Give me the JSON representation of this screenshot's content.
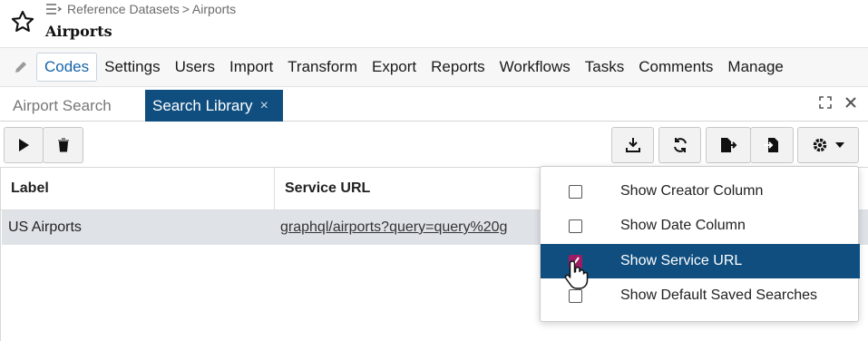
{
  "breadcrumb": {
    "parent": "Reference Datasets",
    "separator": ">",
    "current": "Airports"
  },
  "page_title": "Airports",
  "nav": [
    "Codes",
    "Settings",
    "Users",
    "Import",
    "Transform",
    "Export",
    "Reports",
    "Workflows",
    "Tasks",
    "Comments",
    "Manage"
  ],
  "tabs": {
    "inactive": "Airport Search",
    "active": "Search Library",
    "close": "×"
  },
  "table": {
    "columns": [
      "Label",
      "Service URL"
    ],
    "rows": [
      {
        "label": "US Airports",
        "url": "graphql/airports?query=query%20g"
      }
    ]
  },
  "menu": [
    {
      "label": "Show Creator Column",
      "checked": false
    },
    {
      "label": "Show Date Column",
      "checked": false
    },
    {
      "label": "Show Service URL",
      "checked": true
    },
    {
      "label": "Show Default Saved Searches",
      "checked": false
    }
  ],
  "colors": {
    "accent": "#0f4e7f",
    "link": "#1565a9",
    "checkbox_checked": "#9c1d63",
    "row_selected": "#dfe3e8"
  }
}
